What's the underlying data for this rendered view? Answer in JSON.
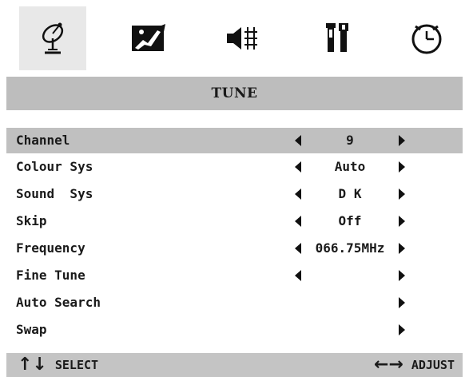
{
  "tabs": [
    {
      "icon": "satellite-dish-icon",
      "active": true
    },
    {
      "icon": "picture-icon",
      "active": false
    },
    {
      "icon": "speaker-icon",
      "active": false
    },
    {
      "icon": "tools-icon",
      "active": false
    },
    {
      "icon": "clock-icon",
      "active": false
    }
  ],
  "title": "TUNE",
  "menu": [
    {
      "label": "Channel",
      "value": "9",
      "left_arrow": true,
      "right_arrow": true,
      "selected": true
    },
    {
      "label": "Colour Sys",
      "value": "Auto",
      "left_arrow": true,
      "right_arrow": true
    },
    {
      "label": "Sound  Sys",
      "value": "D K",
      "left_arrow": true,
      "right_arrow": true
    },
    {
      "label": "Skip",
      "value": "Off",
      "left_arrow": true,
      "right_arrow": true
    },
    {
      "label": "Frequency",
      "value": "066.75MHz",
      "left_arrow": true,
      "right_arrow": true
    },
    {
      "label": "Fine Tune",
      "value": "",
      "left_arrow": true,
      "right_arrow": true
    },
    {
      "label": "Auto Search",
      "value": "",
      "left_arrow": false,
      "right_arrow": true
    },
    {
      "label": "Swap",
      "value": "",
      "left_arrow": false,
      "right_arrow": true
    }
  ],
  "footer": {
    "select_arrows": "↑↓",
    "select_label": "SELECT",
    "adjust_arrows": "←→",
    "adjust_label": "ADJUST"
  }
}
